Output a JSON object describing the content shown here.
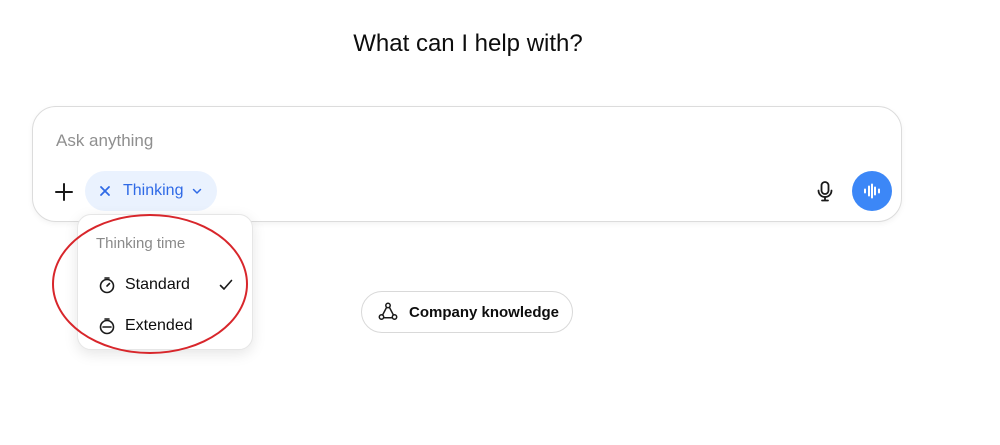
{
  "heading": "What can I help with?",
  "composer": {
    "placeholder": "Ask anything",
    "add_icon": "plus-icon",
    "chip": {
      "label": "Thinking",
      "remove_icon": "close-icon",
      "dropdown_icon": "chevron-down-icon",
      "text_color": "#2f6ae6",
      "background": "#eaf2fe"
    },
    "mic_icon": "microphone-icon",
    "voice_icon": "voice-waveform-icon",
    "voice_button_color": "#3c87f7"
  },
  "thinking_menu": {
    "title": "Thinking time",
    "items": [
      {
        "label": "Standard",
        "icon": "timer-icon",
        "selected": true
      },
      {
        "label": "Extended",
        "icon": "timer-icon",
        "selected": false
      }
    ],
    "check_icon": "checkmark-icon"
  },
  "annotation": {
    "shape": "ellipse",
    "color": "#d8262b"
  },
  "company_knowledge": {
    "label": "Company knowledge",
    "icon": "knowledge-network-icon"
  }
}
